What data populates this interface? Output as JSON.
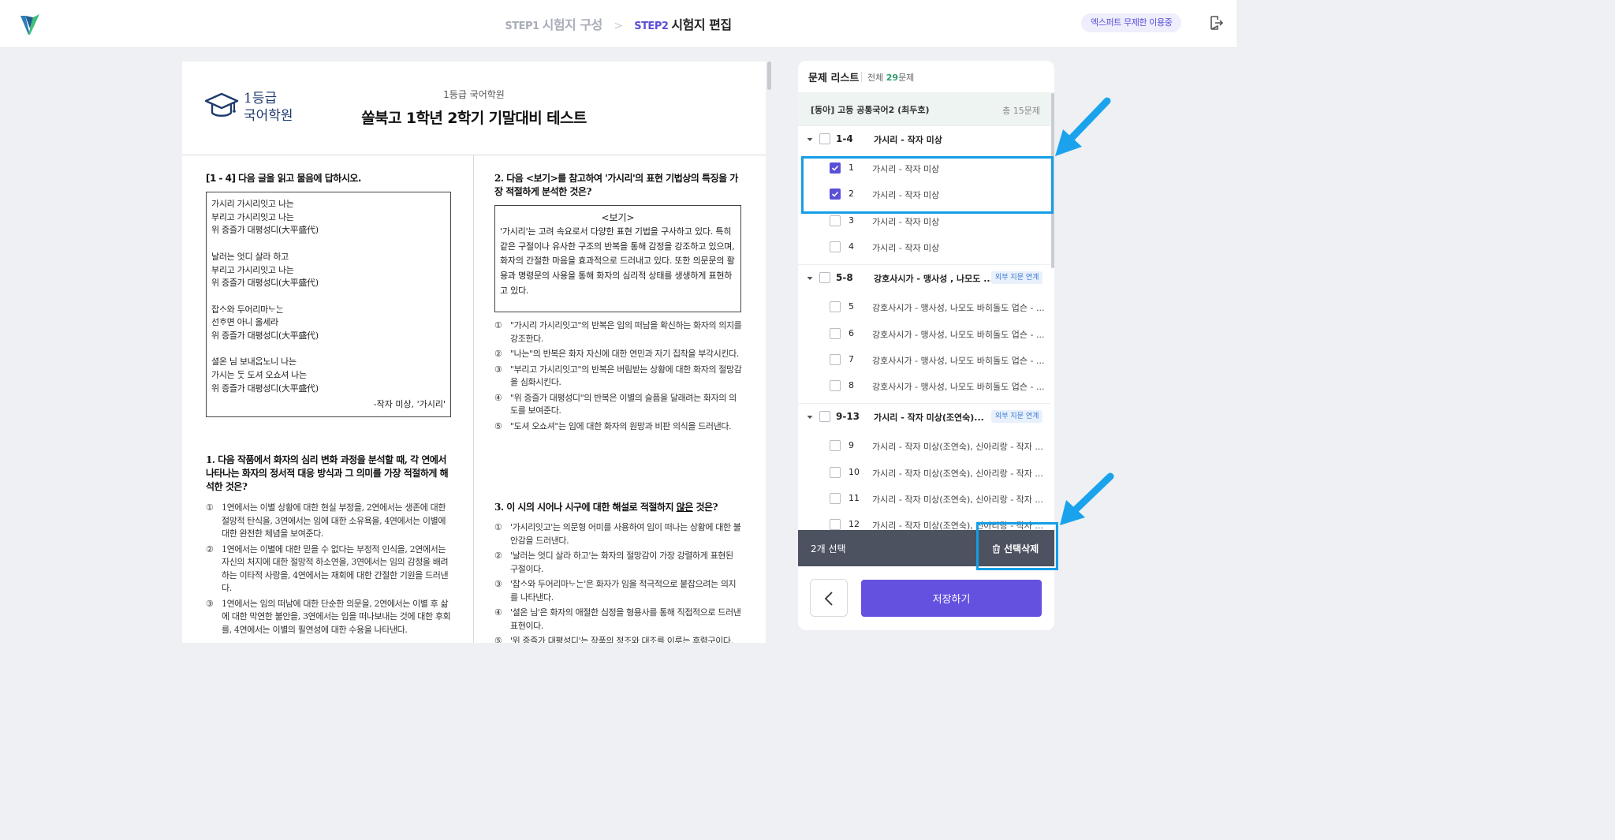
{
  "header": {
    "step1_num": "STEP1",
    "step1_name": "시험지 구성",
    "step2_num": "STEP2",
    "step2_name": "시험지 편집",
    "plan_badge": "엑스퍼트 무제한 이용중"
  },
  "paper": {
    "academy_name": "1등급\n국어학원",
    "subtitle": "1등급 국어학원",
    "title": "쏠북고 1학년 2학기 기말대비 테스트",
    "left": {
      "instruction": "[1 - 4] 다음 글을 읽고 물음에 답하시오.",
      "poem": [
        "가시리 가시리잇고 나는",
        "부리고 가시리잇고 나는",
        "위 증즐가 대평성디(大平盛代)",
        "",
        "날러는 엇디 살라 하고",
        "부리고 가시리잇고 나는",
        "위 증즐가 대평성디(大平盛代)",
        "",
        "잡ᄉᆞ와 두어리마ᄂᆞᄂᆞᆫ",
        "선ᄒᆞ면 아니 올세라",
        "위 증즐가 대평성디(大平盛代)",
        "",
        "셜온 님 보내ᄋᆞᆸ노니 나는",
        "가시는 ᄃᆞᆺ 도셔 오쇼셔 나는",
        "위 증즐가 대평성디(大平盛代)"
      ],
      "poem_author": "-작자 미상, '가시리'",
      "q1": "1. 다음 작품에서 화자의 심리 변화 과정을 분석할 때, 각 연에서 나타나는 화자의 정서적 대응 방식과 그 의미를 가장 적절하게 해석한 것은?",
      "q1_options": [
        {
          "n": "①",
          "t": "1연에서는 이별 상황에 대한 현실 부정을, 2연에서는 생존에 대한 절망적 탄식을, 3연에서는 임에 대한 소유욕을, 4연에서는 이별에 대한 완전한 체념을 보여준다."
        },
        {
          "n": "②",
          "t": "1연에서는 이별에 대한 믿을 수 없다는 부정적 인식을, 2연에서는 자신의 처지에 대한 절망적 하소연을, 3연에서는 임의 감정을 배려하는 이타적 사랑을, 4연에서는 재회에 대한 간절한 기원을 드러낸다."
        },
        {
          "n": "③",
          "t": "1연에서는 임의 떠남에 대한 단순한 의문을, 2연에서는 이별 후 삶에 대한 막연한 불안을, 3연에서는 임을 떠나보내는 것에 대한 후회를, 4연에서는 이별의 필연성에 대한 수용을 나타낸다."
        }
      ]
    },
    "right": {
      "q2": "2. 다음 <보기>를 참고하여 '가시리'의 표현 기법상의 특징을 가장 적절하게 분석한 것은?",
      "bogi_title": "<보기>",
      "bogi_text": "'가시리'는 고려 속요로서 다양한 표현 기법을 구사하고 있다. 특히 같은 구절이나 유사한 구조의 반복을 통해 감정을 강조하고 있으며, 화자의 간절한 마음을 효과적으로 드러내고 있다. 또한 의문문의 활용과 명령문의 사용을 통해 화자의 심리적 상태를 생생하게 표현하고 있다.",
      "q2_options": [
        {
          "n": "①",
          "t": "\"가시리 가시리잇고\"의 반복은 임의 떠남을 확신하는 화자의 의지를 강조한다."
        },
        {
          "n": "②",
          "t": "\"나는\"의 반복은 화자 자신에 대한 연민과 자기 집착을 부각시킨다."
        },
        {
          "n": "③",
          "t": "\"부리고 가시리잇고\"의 반복은 버림받는 상황에 대한 화자의 절망감을 심화시킨다."
        },
        {
          "n": "④",
          "t": "\"위 증즐가 대평성디\"의 반복은 이별의 슬픔을 달래려는 화자의 의도를 보여준다."
        },
        {
          "n": "⑤",
          "t": "\"도셔 오쇼셔\"는 임에 대한 화자의 원망과 비판 의식을 드러낸다."
        }
      ],
      "q3_pre": "3. 이 시의 시어나 시구에 대한 해설로 적절하지 ",
      "q3_under": "않은",
      "q3_post": " 것은?",
      "q3_options": [
        {
          "n": "①",
          "t": "'가시리잇고'는 의문형 어미를 사용하여 임이 떠나는 상황에 대한 불안감을 드러낸다."
        },
        {
          "n": "②",
          "t": "'날러는 엇디 살라 하고'는 화자의 절망감이 가장 강렬하게 표현된 구절이다."
        },
        {
          "n": "③",
          "t": "'잡ᄉᆞ와 두어리마ᄂᆞᄂᆞᆫ'은 화자가 임을 적극적으로 붙잡으려는 의지를 나타낸다."
        },
        {
          "n": "④",
          "t": "'셜온 님'은 화자의 애절한 심정을 형용사를 통해 직접적으로 드러낸 표현이다."
        },
        {
          "n": "⑤",
          "t": "'위 증즐가 대평성디'는 작품의 정조와 대조를 이루는 후렴구이다."
        }
      ]
    }
  },
  "panel": {
    "title": "문제 리스트",
    "total_label": "전체",
    "total_count": "29",
    "total_unit": "문제",
    "book_name": "[동아] 고등 공통국어2 (최두호)",
    "book_count": "총 15문제",
    "groups": [
      {
        "range": "1-4",
        "title": "가시리 - 작자 미상",
        "tag": "",
        "items": [
          {
            "num": "1",
            "title": "가시리 - 작자 미상",
            "checked": true
          },
          {
            "num": "2",
            "title": "가시리 - 작자 미상",
            "checked": true
          },
          {
            "num": "3",
            "title": "가시리 - 작자 미상",
            "checked": false
          },
          {
            "num": "4",
            "title": "가시리 - 작자 미상",
            "checked": false
          }
        ]
      },
      {
        "range": "5-8",
        "title": "강호사시가 - 맹사성 , 나모도 ...",
        "tag": "외부 지문 연계",
        "items": [
          {
            "num": "5",
            "title": "강호사시가 - 맹사성, 나모도 바히돌도 업슨 - ...",
            "checked": false
          },
          {
            "num": "6",
            "title": "강호사시가 - 맹사성, 나모도 바히돌도 업슨 - ...",
            "checked": false
          },
          {
            "num": "7",
            "title": "강호사시가 - 맹사성, 나모도 바히돌도 업슨 - ...",
            "checked": false
          },
          {
            "num": "8",
            "title": "강호사시가 - 맹사성, 나모도 바히돌도 업슨 - ...",
            "checked": false
          }
        ]
      },
      {
        "range": "9-13",
        "title": "가시리 - 작자 미상(조연숙)...",
        "tag": "외부 지문 연계",
        "items": [
          {
            "num": "9",
            "title": "가시리 - 작자 미상(조연숙), 신아리랑 - 작자 ...",
            "checked": false
          },
          {
            "num": "10",
            "title": "가시리 - 작자 미상(조연숙), 신아리랑 - 작자 ...",
            "checked": false
          },
          {
            "num": "11",
            "title": "가시리 - 작자 미상(조연숙), 신아리랑 - 작자 ...",
            "checked": false
          },
          {
            "num": "12",
            "title": "가시리 - 작자 미상(조연숙), 신아리랑 - 작자 ...",
            "checked": false
          }
        ]
      }
    ],
    "selected_label": "2개 선택",
    "delete_label": "선택삭제",
    "save_label": "저장하기"
  },
  "colors": {
    "accent": "#5a4fd8",
    "save_button": "#6451e0",
    "select_bar": "#4d5261",
    "highlight": "#159ee6",
    "count_green": "#2f9e6e"
  },
  "icons": [
    "logo-icon",
    "exit-icon",
    "graduation-cap-icon",
    "chevron-down-icon",
    "check-icon",
    "trash-icon",
    "chevron-left-icon"
  ]
}
